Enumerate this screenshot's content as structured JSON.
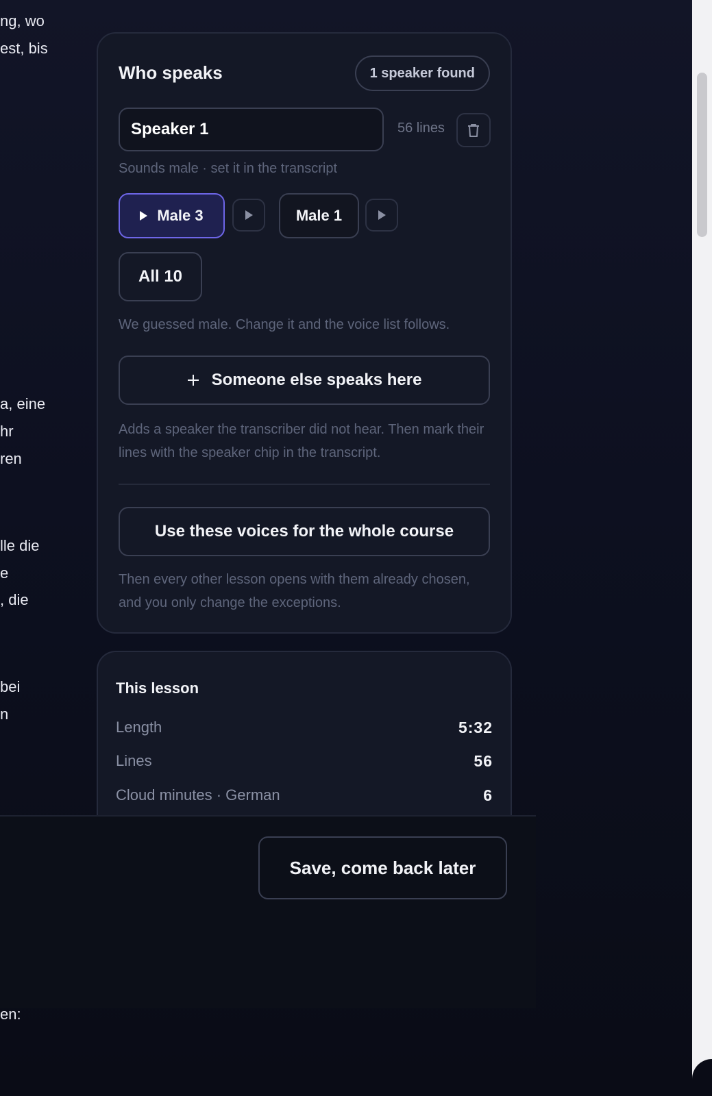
{
  "transcript_fragments": [
    "ng, wo",
    "est, bis",
    "a, eine",
    "hr",
    "ren",
    "lle die",
    "e",
    ", die",
    " bei",
    "n",
    "en:"
  ],
  "speakers_panel": {
    "title": "Who speaks",
    "speaker_count": "1 speaker found",
    "speaker": {
      "name": "Speaker 1",
      "line_count": "56 lines",
      "gender_hint": "Sounds male · set it in the transcript"
    },
    "voices": [
      {
        "label": "Male 3",
        "selected": true
      },
      {
        "label": "Male 1",
        "selected": false
      }
    ],
    "all_voices_label": "All 10",
    "guess_note": "We guessed male. Change it and the voice list follows.",
    "add_speaker_label": "Someone else speaks here",
    "add_speaker_help": "Adds a speaker the transcriber did not hear. Then mark their lines with the speaker chip in the transcript.",
    "apply_course_label": "Use these voices for the whole course",
    "apply_course_help": "Then every other lesson opens with them already chosen, and you only change the exceptions."
  },
  "lesson": {
    "title": "This lesson",
    "stats": [
      {
        "label": "Length",
        "value": "5:32"
      },
      {
        "label": "Lines",
        "value": "56"
      },
      {
        "label": "Cloud minutes · German",
        "value": "6"
      }
    ]
  },
  "footer": {
    "save_label": "Save, come back later"
  },
  "colors": {
    "accent": "#6e66e8",
    "selected_bg": "#1f2150",
    "panel_bg": "#141826",
    "page_bg": "#0d1020"
  }
}
